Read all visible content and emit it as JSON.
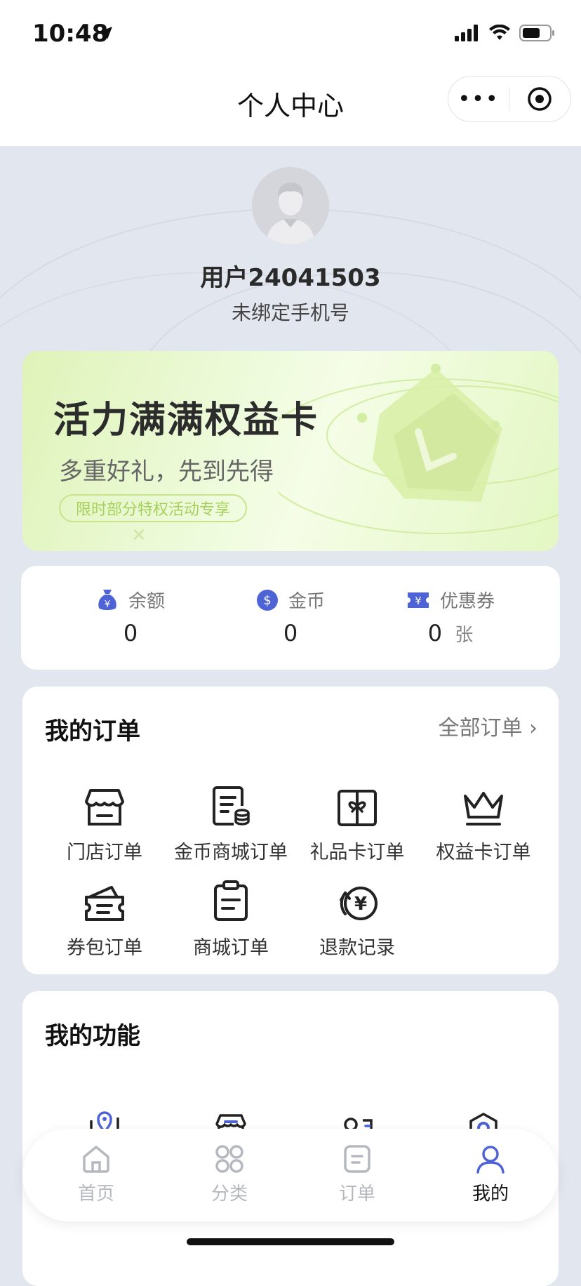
{
  "status_bar": {
    "time": "10:48",
    "icons": [
      "location-arrow-icon",
      "cellular-signal-icon",
      "wifi-icon",
      "battery-icon"
    ]
  },
  "navbar": {
    "title": "个人中心",
    "more_label": "•••",
    "icons": [
      "more-icon",
      "target-icon"
    ]
  },
  "profile": {
    "avatar_icon": "avatar-placeholder-icon",
    "username": "用户24041503",
    "phone_status": "未绑定手机号"
  },
  "banner": {
    "title": "活力满满权益卡",
    "subtitle": "多重好礼，先到先得",
    "tag": "限时部分特权活动专享",
    "close": "✕",
    "colors": {
      "start": "#dff3b8",
      "end": "#e3f7c3",
      "accent": "#a6cf5c"
    }
  },
  "assets": {
    "items": [
      {
        "label": "余额",
        "value": "0",
        "unit": "",
        "icon": "money-bag-icon"
      },
      {
        "label": "金币",
        "value": "0",
        "unit": "",
        "icon": "dollar-coin-icon"
      },
      {
        "label": "优惠券",
        "value": "0",
        "unit": "张",
        "icon": "coupon-icon"
      }
    ],
    "icon_color": "#4d63d6"
  },
  "orders": {
    "title": "我的订单",
    "all_link": "全部订单 ›",
    "items": [
      {
        "label": "门店订单",
        "icon": "store-icon"
      },
      {
        "label": "金币商城订单",
        "icon": "coin-mall-order-icon"
      },
      {
        "label": "礼品卡订单",
        "icon": "gift-card-icon"
      },
      {
        "label": "权益卡订单",
        "icon": "crown-icon"
      },
      {
        "label": "券包订单",
        "icon": "coupon-wallet-icon"
      },
      {
        "label": "商城订单",
        "icon": "clipboard-icon"
      },
      {
        "label": "退款记录",
        "icon": "refund-icon"
      }
    ]
  },
  "functions": {
    "title": "我的功能",
    "items": [
      {
        "icon": "map-pin-icon"
      },
      {
        "icon": "store-icon"
      },
      {
        "icon": "member-card-icon"
      },
      {
        "icon": "settings-hex-icon"
      }
    ],
    "accent": "#4d63d6"
  },
  "tabbar": {
    "items": [
      {
        "label": "首页",
        "icon": "home-icon",
        "active": false
      },
      {
        "label": "分类",
        "icon": "category-icon",
        "active": false
      },
      {
        "label": "订单",
        "icon": "order-icon",
        "active": false
      },
      {
        "label": "我的",
        "icon": "user-icon",
        "active": true
      }
    ],
    "active_color": "#4d63d6",
    "inactive_color": "#b5b8bf"
  }
}
